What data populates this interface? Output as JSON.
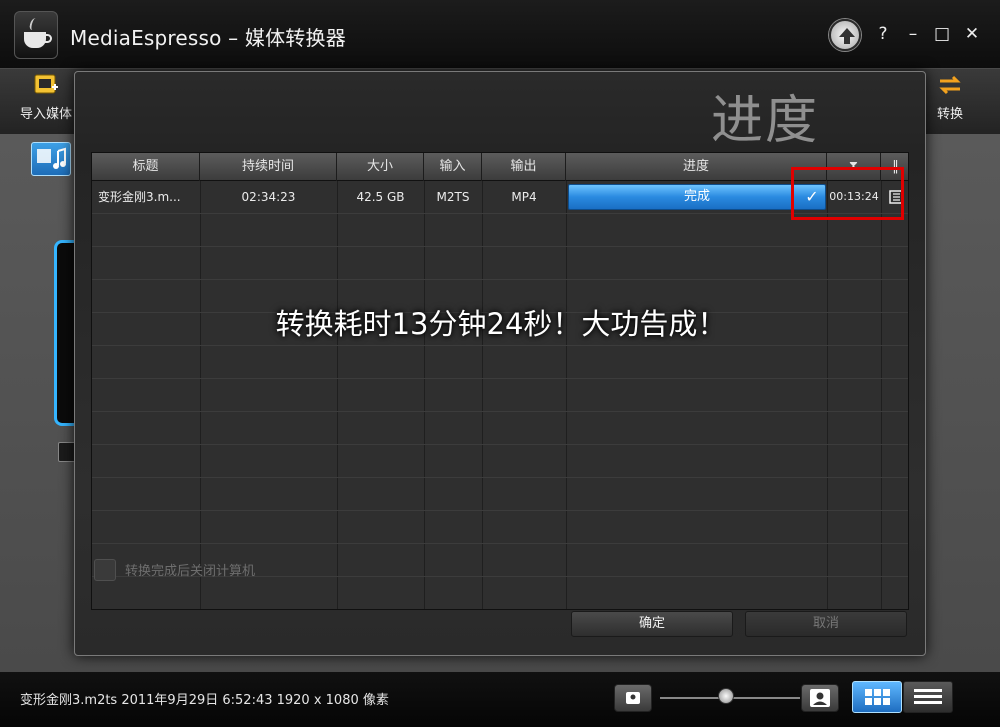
{
  "window": {
    "title": "MediaEspresso – 媒体转换器",
    "help_label": "?",
    "minimize_label": "–",
    "maximize_label": "□",
    "close_label": "✕"
  },
  "toolbar": {
    "import_label": "导入媒体",
    "convert_label": "转换"
  },
  "dialog": {
    "title": "进度",
    "columns": [
      "标题",
      "持续时间",
      "大小",
      "输入",
      "输出",
      "进度",
      "⧗",
      "‖"
    ],
    "row": {
      "title": "变形金刚3.m...",
      "duration": "02:34:23",
      "size": "42.5 GB",
      "input": "M2TS",
      "output": "MP4",
      "progress_label": "完成",
      "progress": 1.0,
      "elapsed": "00:13:24"
    },
    "overlay_message": "转换耗时13分钟24秒！大功告成！",
    "shutdown_label": "转换完成后关闭计算机",
    "ok_label": "确定",
    "cancel_label": "取消"
  },
  "statusbar": {
    "file_info": "变形金刚3.m2ts  2011年9月29日 6:52:43  1920 x 1080 像素"
  },
  "colors": {
    "accent_blue": "#2a8ae0",
    "highlight_red": "#e00000"
  }
}
